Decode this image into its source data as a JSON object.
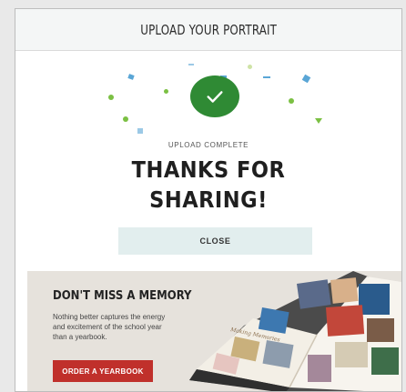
{
  "modal": {
    "title": "UPLOAD YOUR PORTRAIT",
    "status": "UPLOAD COMPLETE",
    "headline_line1": "THANKS FOR",
    "headline_line2": "SHARING!",
    "close_label": "CLOSE"
  },
  "promo": {
    "title": "DON'T MISS A MEMORY",
    "body_line1": "Nothing better captures the energy",
    "body_line2": "and excitement of the school year",
    "body_line3": "than a yearbook.",
    "button_label": "ORDER A YEARBOOK",
    "yearbook_script": "Making Memories"
  },
  "colors": {
    "success_green": "#2f8a34",
    "accent_red": "#c0302b",
    "close_bg": "#e2eeee",
    "confetti_blue": "#5aa6d6",
    "confetti_green": "#7bc043"
  },
  "icons": {
    "check": "check-icon",
    "confetti": "confetti-icon"
  }
}
